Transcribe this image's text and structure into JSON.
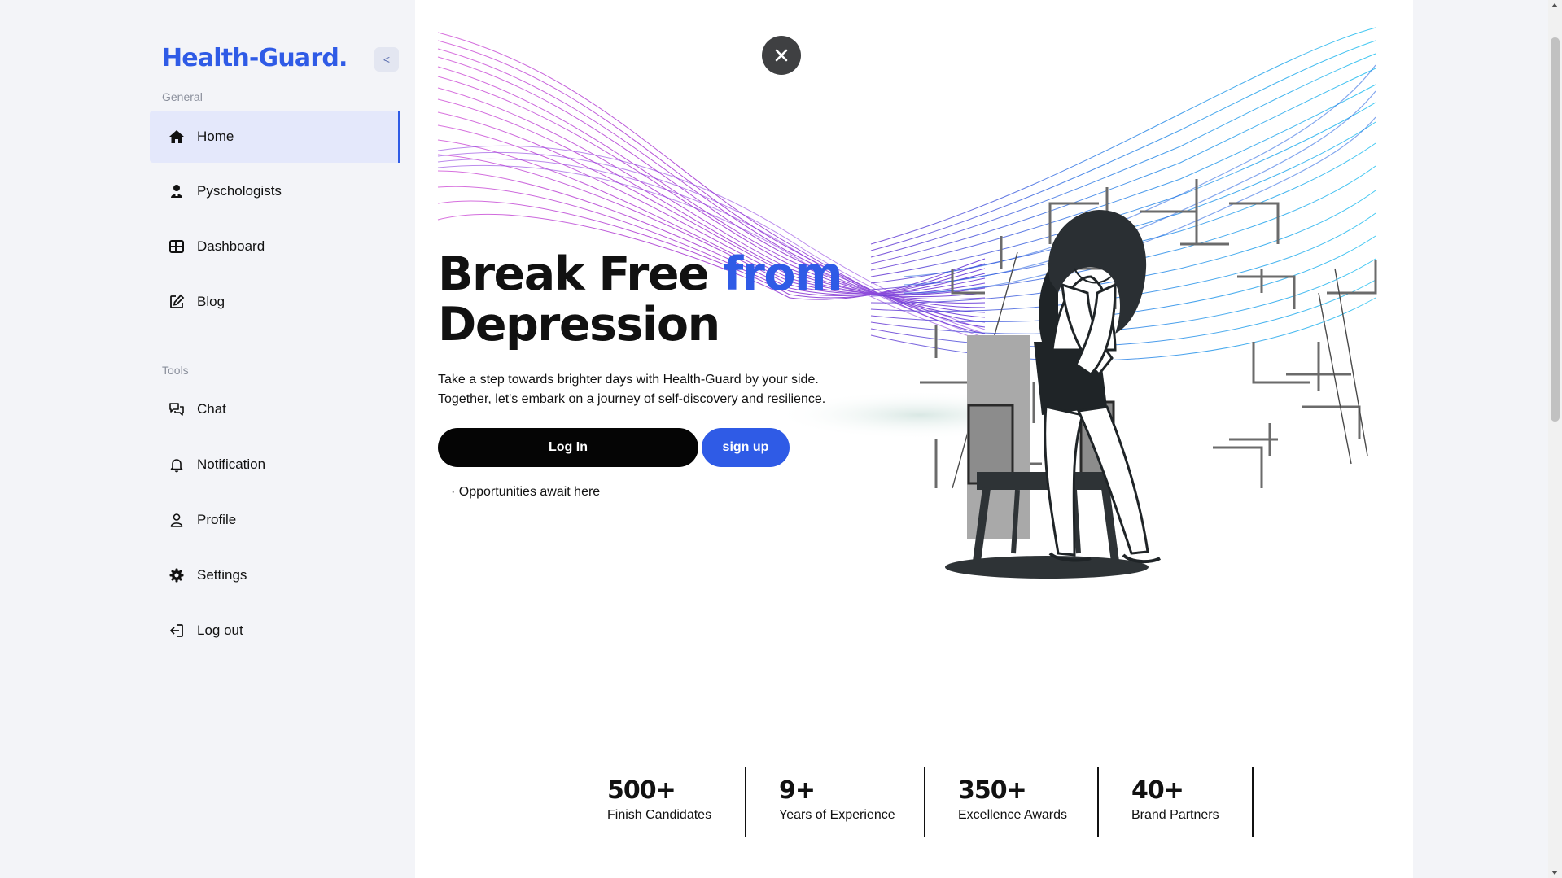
{
  "brand": {
    "name": "Health-Guard.",
    "collapse_label": "<"
  },
  "sidebar": {
    "general_label": "General",
    "tools_label": "Tools",
    "general_items": [
      {
        "label": "Home",
        "icon": "home-icon",
        "active": true
      },
      {
        "label": "Pyschologists",
        "icon": "psychologist-icon"
      },
      {
        "label": "Dashboard",
        "icon": "dashboard-icon"
      },
      {
        "label": "Blog",
        "icon": "edit-icon"
      }
    ],
    "tools_items": [
      {
        "label": "Chat",
        "icon": "chat-icon"
      },
      {
        "label": "Notification",
        "icon": "bell-icon"
      },
      {
        "label": "Profile",
        "icon": "user-icon"
      },
      {
        "label": "Settings",
        "icon": "gear-icon"
      },
      {
        "label": "Log out",
        "icon": "logout-icon"
      }
    ]
  },
  "hero": {
    "title_part1": "Break Free ",
    "title_accent": "from",
    "title_part2": "Depression",
    "desc_line1": "Take a step towards brighter days with Health-Guard by your side.",
    "desc_line2": "Together, let's embark on a journey of self-discovery and resilience.",
    "login_label": "Log In",
    "signup_label": "sign up",
    "note": "· Opportunities await here"
  },
  "stats": [
    {
      "value": "500+",
      "label": "Finish Candidates"
    },
    {
      "value": "9+",
      "label": "Years of Experience"
    },
    {
      "value": "350+",
      "label": "Excellence Awards"
    },
    {
      "value": "40+",
      "label": "Brand Partners"
    }
  ],
  "colors": {
    "accent": "#2f5be6",
    "sidebar_bg": "#f3f4f8",
    "active_bg": "#e4e8fb"
  }
}
